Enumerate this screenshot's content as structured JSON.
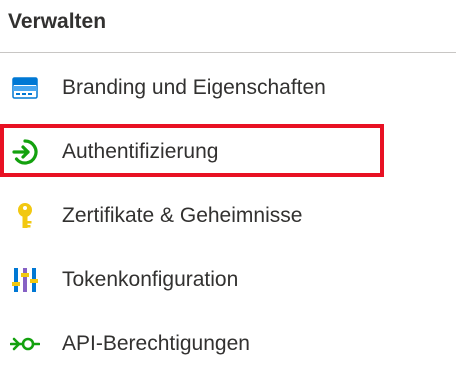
{
  "section": {
    "title": "Verwalten"
  },
  "menu": {
    "items": [
      {
        "label": "Branding und Eigenschaften",
        "icon": "branding-icon"
      },
      {
        "label": "Authentifizierung",
        "icon": "authentication-icon",
        "highlighted": true
      },
      {
        "label": "Zertifikate & Geheimnisse",
        "icon": "key-icon"
      },
      {
        "label": "Tokenkonfiguration",
        "icon": "token-configuration-icon"
      },
      {
        "label": "API-Berechtigungen",
        "icon": "api-permissions-icon"
      }
    ]
  },
  "colors": {
    "text": "#323130",
    "divider": "#c8c6c4",
    "highlight_border": "#e81123",
    "branding_blue": "#0078d4",
    "auth_green": "#13a10e",
    "key_yellow": "#f2c811",
    "token_blue": "#0078d4",
    "token_purple": "#8661c5",
    "api_green": "#13a10e"
  }
}
